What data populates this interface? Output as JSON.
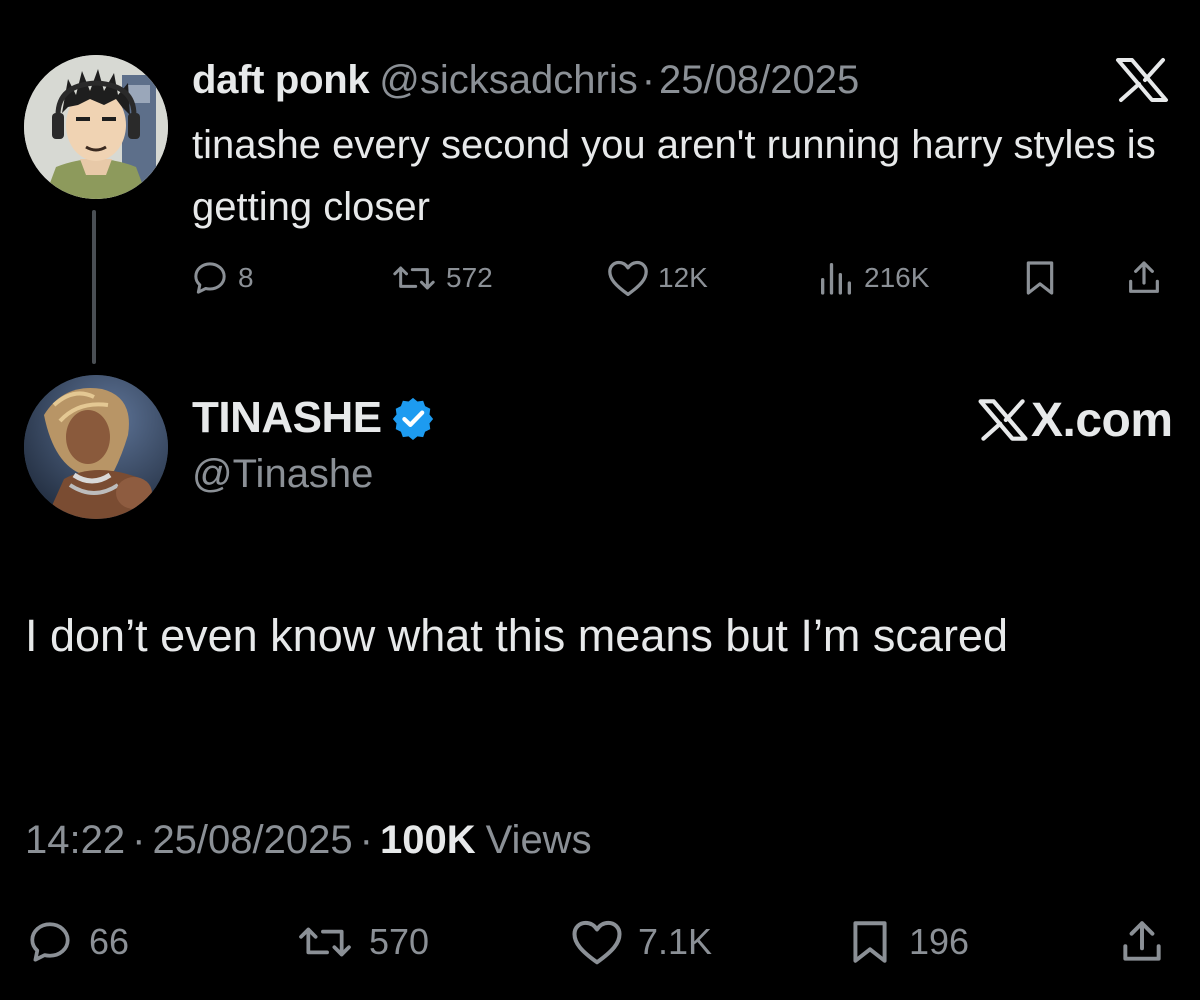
{
  "parent_tweet": {
    "display_name": "daft ponk",
    "handle": "@sicksadchris",
    "separator": "·",
    "date": "25/08/2025",
    "text": "tinashe every second you aren't running harry styles is getting closer",
    "actions": {
      "replies": "8",
      "reposts": "572",
      "likes": "12K",
      "views": "216K"
    },
    "icons": [
      "reply-icon",
      "repost-icon",
      "like-icon",
      "views-icon",
      "bookmark-icon",
      "share-icon",
      "x-logo-icon"
    ]
  },
  "main_tweet": {
    "display_name": "TINASHE",
    "verified": true,
    "handle": "@Tinashe",
    "watermark": "X.com",
    "text": "I don’t even know what this means but I’m scared",
    "time": "14:22",
    "separator": "·",
    "date": "25/08/2025",
    "views_count": "100K",
    "views_label": "Views",
    "actions": {
      "replies": "66",
      "reposts": "570",
      "likes": "7.1K",
      "bookmarks": "196"
    }
  },
  "colors": {
    "background": "#000000",
    "primary_text": "#e7e9ea",
    "secondary_text": "#8b9096",
    "verified_blue": "#1d9bf0",
    "thread_line": "#4a4f54"
  }
}
